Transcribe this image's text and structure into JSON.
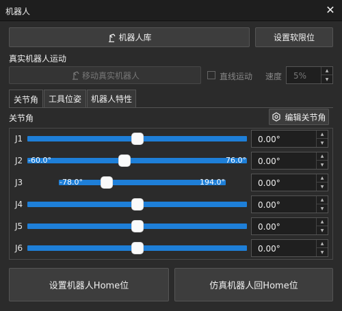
{
  "window": {
    "title": "机器人"
  },
  "toolbar": {
    "library_label": "机器人库",
    "soft_limit_label": "设置软限位"
  },
  "real_robot": {
    "section_label": "真实机器人运动",
    "move_label": "移动真实机器人",
    "linear_label": "直线运动",
    "speed_label": "速度",
    "speed_value": "5%"
  },
  "tabs": [
    {
      "label": "关节角"
    },
    {
      "label": "工具位姿"
    },
    {
      "label": "机器人特性"
    }
  ],
  "joints_section": {
    "label": "关节角",
    "edit_label": "编辑关节角"
  },
  "joints": [
    {
      "name": "J1",
      "value": "0.00°",
      "min_label": "",
      "max_label": "",
      "position_fraction": 0.5
    },
    {
      "name": "J2",
      "value": "0.00°",
      "min_label": "-60.0°",
      "max_label": "76.0°",
      "position_fraction": 0.441
    },
    {
      "name": "J3",
      "value": "0.00°",
      "min_label": "-78.0°",
      "max_label": "194.0°",
      "position_fraction": 0.287
    },
    {
      "name": "J4",
      "value": "0.00°",
      "min_label": "",
      "max_label": "",
      "position_fraction": 0.5
    },
    {
      "name": "J5",
      "value": "0.00°",
      "min_label": "",
      "max_label": "",
      "position_fraction": 0.5
    },
    {
      "name": "J6",
      "value": "0.00°",
      "min_label": "",
      "max_label": "",
      "position_fraction": 0.5
    }
  ],
  "bottom": {
    "set_home_label": "设置机器人Home位",
    "sim_home_label": "仿真机器人回Home位"
  },
  "icons": {
    "close": "close-icon",
    "robot_arm": "robot-arm-icon",
    "edit": "edit-gear-icon",
    "spin_up": "chevron-up-icon",
    "spin_down": "chevron-down-icon"
  },
  "colors": {
    "accent": "#1e7fd8"
  }
}
